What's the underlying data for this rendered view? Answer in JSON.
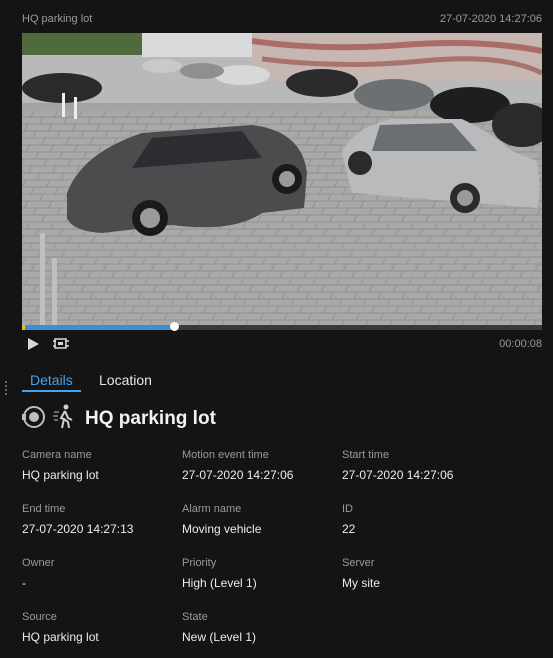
{
  "header": {
    "title": "HQ parking lot",
    "timestamp": "27-07-2020 14:27:06"
  },
  "player": {
    "duration": "00:00:08",
    "progress_fraction": 0.295,
    "play_icon": "play-icon",
    "clip_icon": "export-clip-icon"
  },
  "tabs": [
    {
      "label": "Details",
      "active": true
    },
    {
      "label": "Location",
      "active": false
    }
  ],
  "details": {
    "icons": [
      "camera-icon",
      "motion-person-icon"
    ],
    "title": "HQ parking lot",
    "fields": [
      {
        "label": "Camera name",
        "value": "HQ parking lot"
      },
      {
        "label": "Motion event time",
        "value": "27-07-2020 14:27:06"
      },
      {
        "label": "Start time",
        "value": "27-07-2020 14:27:06"
      },
      {
        "label": "End time",
        "value": "27-07-2020 14:27:13"
      },
      {
        "label": "Alarm name",
        "value": "Moving vehicle"
      },
      {
        "label": "ID",
        "value": "22"
      },
      {
        "label": "Owner",
        "value": "-"
      },
      {
        "label": "Priority",
        "value": "High (Level 1)"
      },
      {
        "label": "Server",
        "value": "My site"
      },
      {
        "label": "Source",
        "value": "HQ parking lot"
      },
      {
        "label": "State",
        "value": "New (Level 1)"
      }
    ]
  },
  "colors": {
    "accent": "#4aa3ea",
    "background": "#141414",
    "marker": "#e0c020"
  }
}
